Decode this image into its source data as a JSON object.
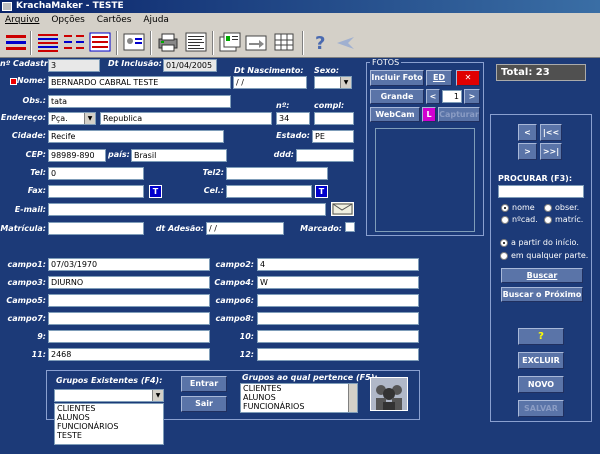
{
  "window": {
    "title": "KrachaMaker - TESTE"
  },
  "menu": [
    "Arquivo",
    "Opções",
    "Cartões",
    "Ajuda"
  ],
  "icons": [
    "red-stripes-icon",
    "red-blue-lines-icon",
    "columns-icon",
    "blue-red-grid-icon",
    "photo-card-icon",
    "printer-icon",
    "form-icon",
    "id-card-icon",
    "card-arrow-icon",
    "grid-icon",
    "help-icon",
    "plane-icon"
  ],
  "labels": {
    "ncadastro": "nº Cadastro:",
    "dtinclusao": "Dt Inclusão:",
    "dtnasc": "Dt Nascimento:",
    "sexo": "Sexo:",
    "nome": "Nome:",
    "obs": "Obs.:",
    "n": "nº:",
    "compl": "compl:",
    "endereco": "Endereço:",
    "cidade": "Cidade:",
    "estado": "Estado:",
    "cep": "CEP:",
    "pais": "país:",
    "ddd": "ddd:",
    "tel": "Tel:",
    "tel2": "Tel2:",
    "fax": "Fax:",
    "cel": "Cel.:",
    "email": "E-mail:",
    "matricula": "Matrícula:",
    "dtadesao": "dt Adesão:",
    "marcado": "Marcado:",
    "campo1": "campo1:",
    "campo2": "campo2:",
    "campo3": "campo3:",
    "campo4": "Campo4:",
    "campo5": "Campo5:",
    "campo6": "campo6:",
    "campo7": "campo7:",
    "campo8": "campo8:",
    "c9": "9:",
    "c10": "10:",
    "c11": "11:",
    "c12": "12:",
    "fotos": "FOTOS",
    "gruposExistentes": "Grupos Existentes (F4):",
    "gruposPertence": "Grupos ao qual pertence (F5):",
    "procurar": "PROCURAR (F3):"
  },
  "fields": {
    "ncadastro": "3",
    "dtinclusao": "01/04/2005",
    "dtnasc": "/ /",
    "sexo": "",
    "nome": "BERNARDO CABRAL TESTE",
    "obs": "tata",
    "tipoLogradouro": "Pça.",
    "endereco": "Republica",
    "numero": "34",
    "compl": "",
    "cidade": "Recife",
    "estado": "PE",
    "cep": "98989-890",
    "pais": "Brasil",
    "ddd": "",
    "tel": "0",
    "tel2": "",
    "fax": "",
    "cel": "",
    "email": "",
    "matricula": "",
    "dtadesao": "/ /",
    "campo1": "07/03/1970",
    "campo2": "4",
    "campo3": "DIURNO",
    "campo4": "W",
    "campo5": "",
    "campo6": "",
    "campo7": "",
    "campo8": "",
    "c9": "",
    "c10": "",
    "c11": "2468",
    "c12": "",
    "procurar": ""
  },
  "fotos": {
    "incluir": "Incluir Foto",
    "ed": "ED",
    "del": "✕",
    "grande": "Grande",
    "prev": "<",
    "index": "1",
    "next": ">",
    "webcam": "WebCam",
    "l": "L",
    "capturar": "Capturar"
  },
  "total": "Total: 23",
  "nav": {
    "prev": "<",
    "first": "|<<",
    "next": ">",
    "last": ">>|"
  },
  "search": {
    "opt1": "nome",
    "opt2": "obser.",
    "opt3": "nºcad.",
    "opt4": "matríc.",
    "opt5": "a partir do início.",
    "opt6": "em qualquer parte.",
    "buscar": "Buscar",
    "buscarProx": "Buscar o Próximo"
  },
  "actions": {
    "help": "?",
    "excluir": "EXCLUIR",
    "novo": "NOVO",
    "salvar": "SALVAR"
  },
  "groups": {
    "existentes": [
      "CLIENTES",
      "ALUNOS",
      "FUNCIONÁRIOS",
      "TESTE"
    ],
    "pertence": [
      "CLIENTES",
      "ALUNOS",
      "FUNCIONÁRIOS"
    ],
    "entrar": "Entrar",
    "sair": "Sair"
  },
  "colors": {
    "bg": "#1c3a78",
    "titlebar": "#0a246a"
  }
}
